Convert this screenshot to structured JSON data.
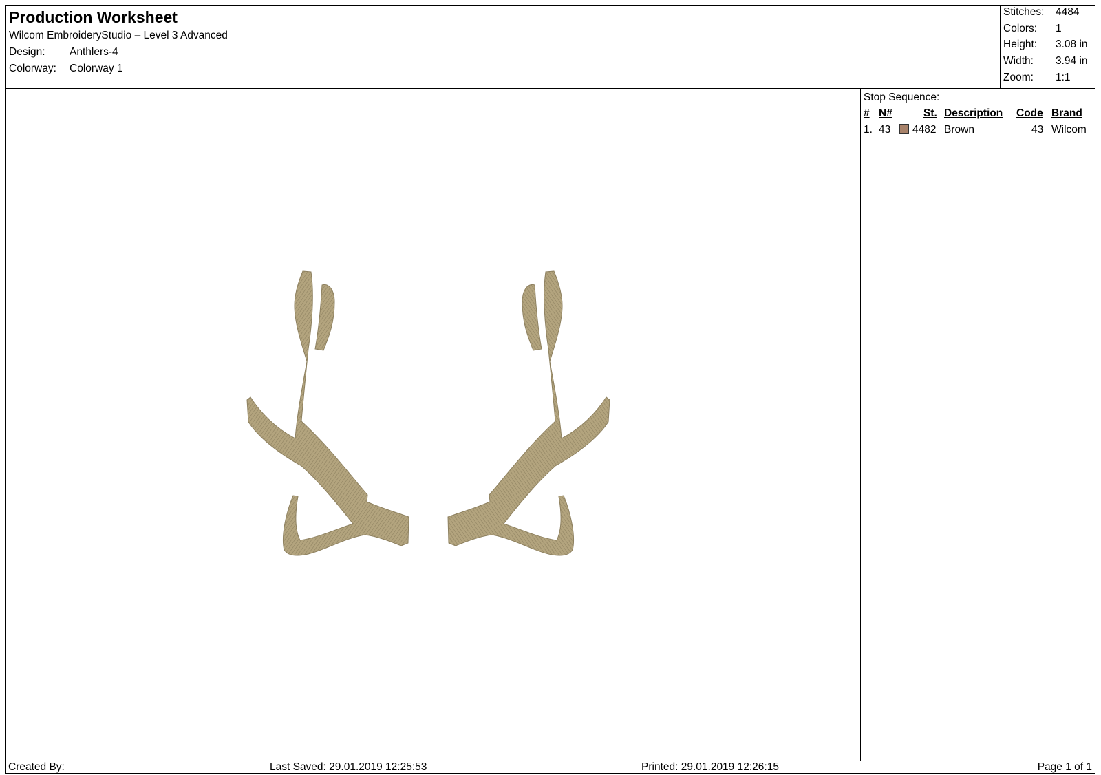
{
  "header": {
    "title": "Production Worksheet",
    "software": "Wilcom EmbroideryStudio – Level 3 Advanced",
    "design_label": "Design:",
    "design_value": "Anthlers-4",
    "colorway_label": "Colorway:",
    "colorway_value": "Colorway 1"
  },
  "stats": {
    "stitches_label": "Stitches:",
    "stitches_value": "4484",
    "colors_label": "Colors:",
    "colors_value": "1",
    "height_label": "Height:",
    "height_value": "3.08 in",
    "width_label": "Width:",
    "width_value": "3.94 in",
    "zoom_label": "Zoom:",
    "zoom_value": "1:1"
  },
  "stop_sequence": {
    "title": "Stop Sequence:",
    "columns": {
      "num": "#",
      "needle": "N#",
      "stitches": "St.",
      "description": "Description",
      "code": "Code",
      "brand": "Brand"
    },
    "rows": [
      {
        "num": "1.",
        "needle": "43",
        "swatch_color": "#a8826a",
        "stitches": "4482",
        "description": "Brown",
        "code": "43",
        "brand": "Wilcom"
      }
    ]
  },
  "design": {
    "thread_color": "#b3a47e",
    "thread_shade": "#8e8160"
  },
  "footer": {
    "created_by": "Created By:",
    "last_saved": "Last Saved: 29.01.2019 12:25:53",
    "printed": "Printed: 29.01.2019 12:26:15",
    "page": "Page 1 of 1"
  }
}
